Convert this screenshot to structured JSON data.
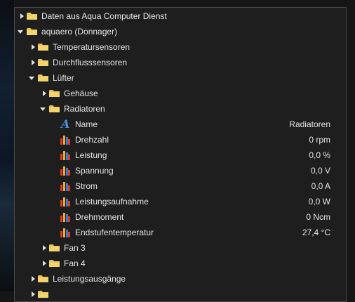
{
  "tree": {
    "root_item": "Daten aus Aqua Computer Dienst",
    "device": "aquaero (Donnager)",
    "temp_sensors": "Temperatursensoren",
    "flow_sensors": "Durchflusssensoren",
    "fans": "Lüfter",
    "case": "Gehäuse",
    "radiators": "Radiatoren",
    "properties": [
      {
        "label": "Name",
        "value": "Radiatoren",
        "icon": "name-icon"
      },
      {
        "label": "Drehzahl",
        "value": "0 rpm",
        "icon": "bar-chart-icon"
      },
      {
        "label": "Leistung",
        "value": "0,0 %",
        "icon": "bar-chart-icon"
      },
      {
        "label": "Spannung",
        "value": "0,0 V",
        "icon": "bar-chart-icon"
      },
      {
        "label": "Strom",
        "value": "0,0 A",
        "icon": "bar-chart-icon"
      },
      {
        "label": "Leistungsaufnahme",
        "value": "0,0 W",
        "icon": "bar-chart-icon"
      },
      {
        "label": "Drehmoment",
        "value": "0 Ncm",
        "icon": "bar-chart-icon"
      },
      {
        "label": "Endstufentemperatur",
        "value": "27,4 °C",
        "icon": "bar-chart-icon"
      }
    ],
    "fan3": "Fan 3",
    "fan4": "Fan 4",
    "power_outputs": "Leistungsausgänge"
  },
  "colors": {
    "folder": "#e8c45a",
    "bar_red": "#e03a2e",
    "bar_yellow": "#f0b020",
    "bar_blue": "#3a78d8",
    "name_icon": "#4a8fe0"
  }
}
